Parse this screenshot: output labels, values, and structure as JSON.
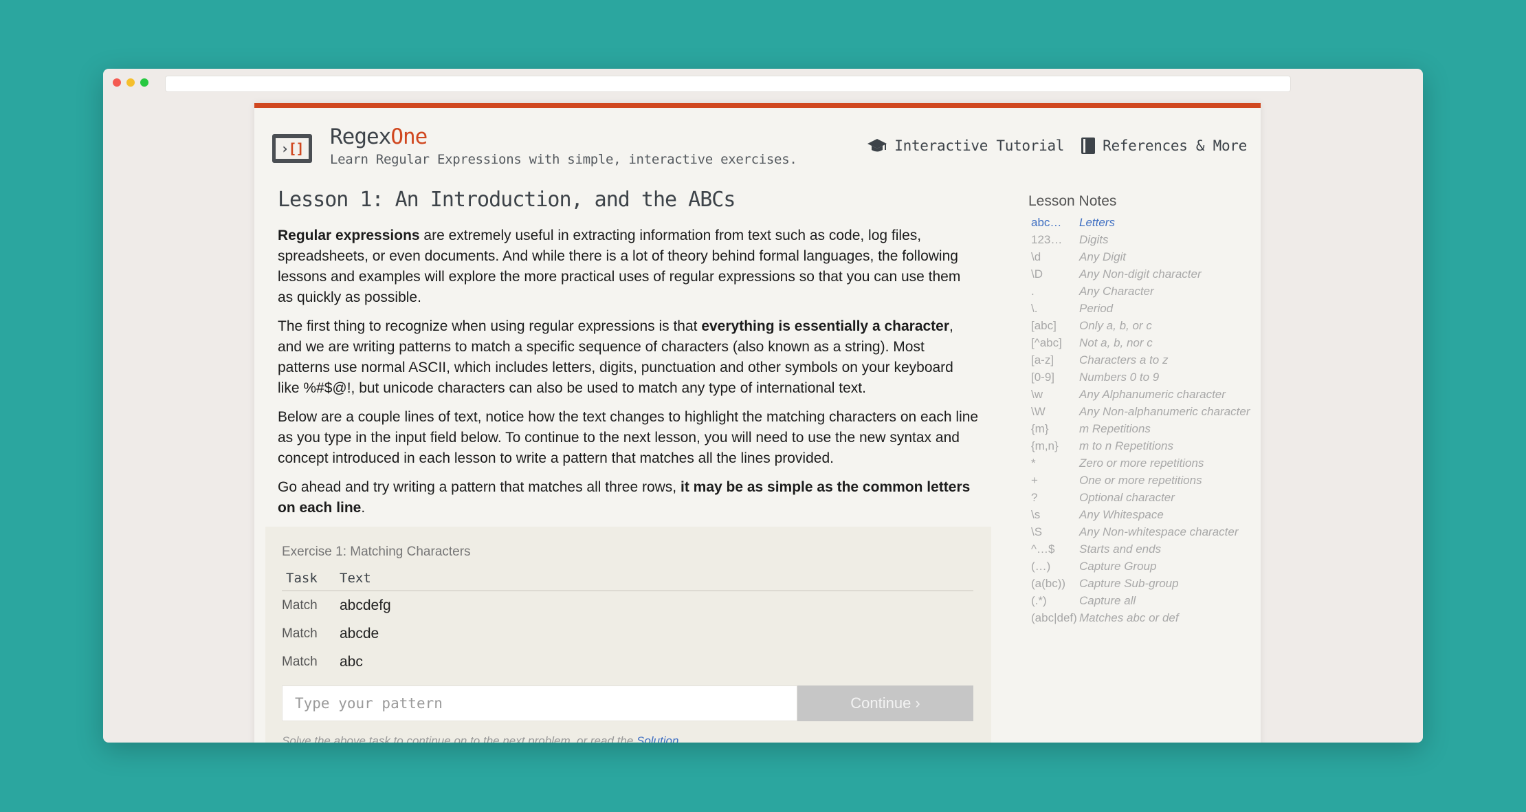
{
  "brand": {
    "name_prefix": "Regex",
    "name_accent": "One",
    "logo_text_left": "›",
    "logo_text_right": "[]",
    "tagline": "Learn Regular Expressions with simple, interactive exercises."
  },
  "nav": {
    "tutorial": "Interactive Tutorial",
    "references": "References & More"
  },
  "lesson": {
    "title": "Lesson 1: An Introduction, and the ABCs",
    "p1": {
      "bold": "Regular expressions",
      "rest": " are extremely useful in extracting information from text such as code, log files, spreadsheets, or even documents. And while there is a lot of theory behind formal languages, the following lessons and examples will explore the more practical uses of regular expressions so that you can use them as quickly as possible."
    },
    "p2": {
      "pre": "The first thing to recognize when using regular expressions is that ",
      "bold": "everything is essentially a character",
      "post": ", and we are writing patterns to match a specific sequence of characters (also known as a string). Most patterns use normal ASCII, which includes letters, digits, punctuation and other symbols on your keyboard like %#$@!, but unicode characters can also be used to match any type of international text."
    },
    "p3": "Below are a couple lines of text, notice how the text changes to highlight the matching characters on each line as you type in the input field below. To continue to the next lesson, you will need to use the new syntax and concept introduced in each lesson to write a pattern that matches all the lines provided.",
    "p4": {
      "pre": "Go ahead and try writing a pattern that matches all three rows, ",
      "bold": "it may be as simple as the common letters on each line",
      "post": "."
    }
  },
  "exercise": {
    "title": "Exercise 1: Matching Characters",
    "col_task": "Task",
    "col_text": "Text",
    "rows": [
      {
        "task": "Match",
        "text": "abcdefg"
      },
      {
        "task": "Match",
        "text": "abcde"
      },
      {
        "task": "Match",
        "text": "abc"
      }
    ],
    "input_placeholder": "Type your pattern",
    "continue_label": "Continue ›",
    "footer_text": "Solve the above task to continue on to the next problem, or read the ",
    "footer_link": "Solution."
  },
  "notes": {
    "title": "Lesson Notes",
    "items": [
      {
        "sym": "abc…",
        "desc": "Letters"
      },
      {
        "sym": "123…",
        "desc": "Digits"
      },
      {
        "sym": "\\d",
        "desc": "Any Digit"
      },
      {
        "sym": "\\D",
        "desc": "Any Non-digit character"
      },
      {
        "sym": ".",
        "desc": "Any Character"
      },
      {
        "sym": "\\.",
        "desc": "Period"
      },
      {
        "sym": "[abc]",
        "desc": "Only a, b, or c"
      },
      {
        "sym": "[^abc]",
        "desc": "Not a, b, nor c"
      },
      {
        "sym": "[a-z]",
        "desc": "Characters a to z"
      },
      {
        "sym": "[0-9]",
        "desc": "Numbers 0 to 9"
      },
      {
        "sym": "\\w",
        "desc": "Any Alphanumeric character"
      },
      {
        "sym": "\\W",
        "desc": "Any Non-alphanumeric character"
      },
      {
        "sym": "{m}",
        "desc": "m Repetitions"
      },
      {
        "sym": "{m,n}",
        "desc": "m to n Repetitions"
      },
      {
        "sym": "*",
        "desc": "Zero or more repetitions"
      },
      {
        "sym": "+",
        "desc": "One or more repetitions"
      },
      {
        "sym": "?",
        "desc": "Optional character"
      },
      {
        "sym": "\\s",
        "desc": "Any Whitespace"
      },
      {
        "sym": "\\S",
        "desc": "Any Non-whitespace character"
      },
      {
        "sym": "^…$",
        "desc": "Starts and ends"
      },
      {
        "sym": "(…)",
        "desc": "Capture Group"
      },
      {
        "sym": "(a(bc))",
        "desc": "Capture Sub-group"
      },
      {
        "sym": "(.*)",
        "desc": "Capture all"
      },
      {
        "sym": "(abc|def)",
        "desc": "Matches abc or def"
      }
    ],
    "active_index": 0
  },
  "colors": {
    "background": "#2ba69f",
    "accent": "#d0471f",
    "link": "#3f6fc2"
  },
  "icons": {
    "tutorial": "graduation-cap-icon",
    "references": "book-icon",
    "window_controls": [
      "close-dot",
      "minimize-dot",
      "zoom-dot"
    ]
  }
}
